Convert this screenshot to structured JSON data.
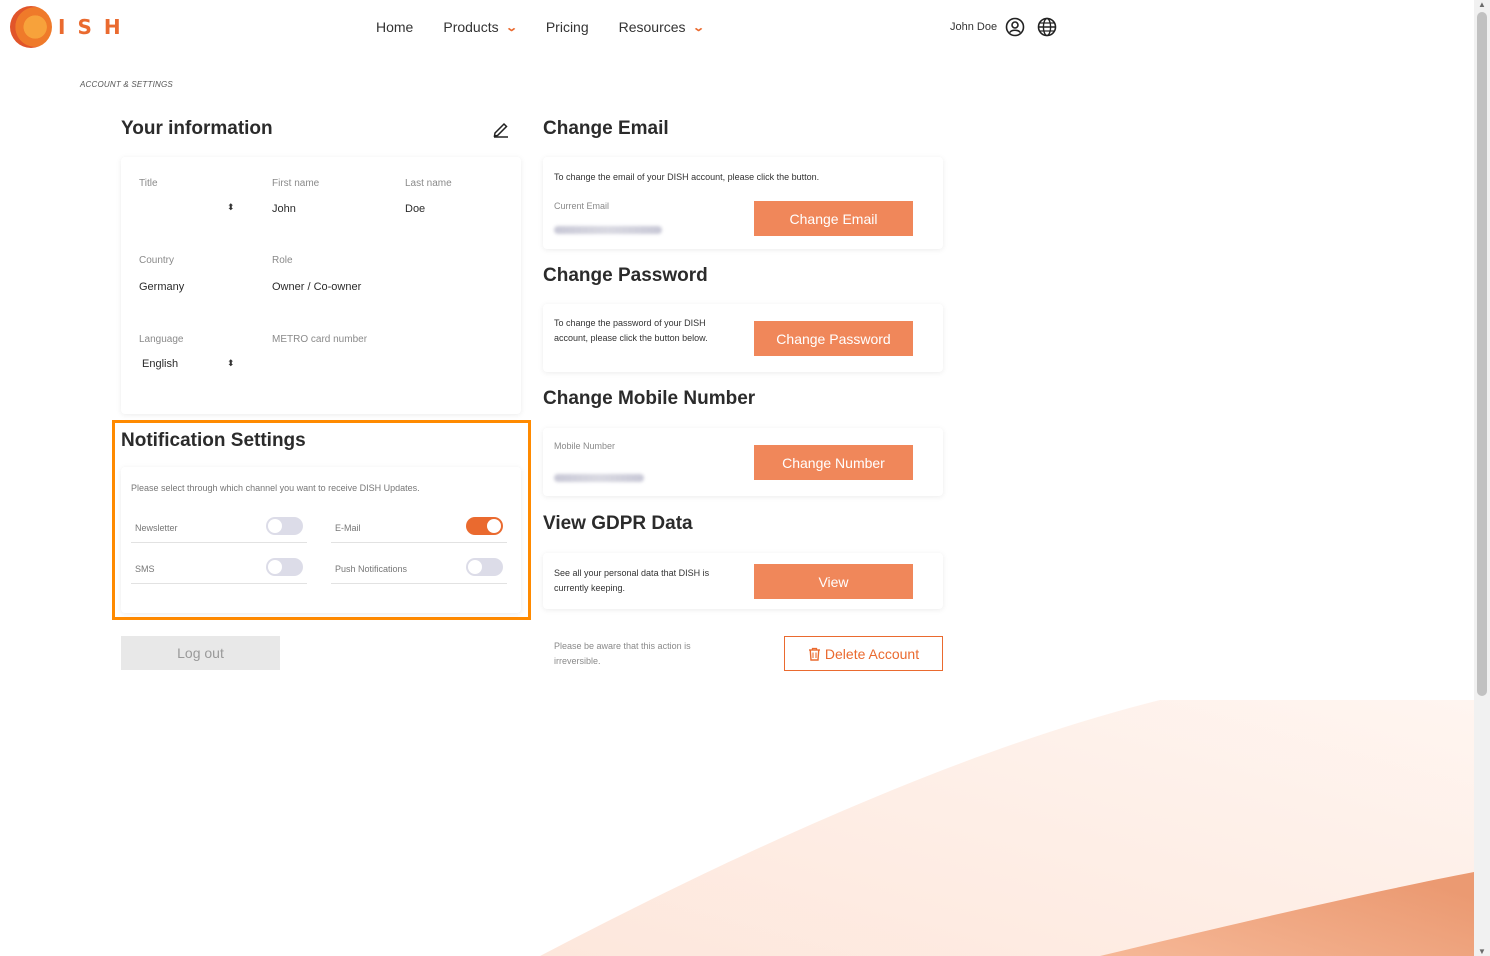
{
  "header": {
    "logo_text": "ISH",
    "nav": [
      {
        "label": "Home",
        "has_dropdown": false
      },
      {
        "label": "Products",
        "has_dropdown": true
      },
      {
        "label": "Pricing",
        "has_dropdown": false
      },
      {
        "label": "Resources",
        "has_dropdown": true
      }
    ],
    "user_name": "John Doe",
    "icons": [
      "user-circle-icon",
      "globe-icon",
      "chevron-down-icon"
    ]
  },
  "breadcrumb": "ACCOUNT & SETTINGS",
  "your_information": {
    "title": "Your information",
    "fields": {
      "title_label": "Title",
      "title_value": "",
      "first_name_label": "First name",
      "first_name_value": "John",
      "last_name_label": "Last name",
      "last_name_value": "Doe",
      "country_label": "Country",
      "country_value": "Germany",
      "role_label": "Role",
      "role_value": "Owner / Co-owner",
      "language_label": "Language",
      "language_value": "English",
      "metro_label": "METRO card number",
      "metro_value": ""
    }
  },
  "notifications": {
    "title": "Notification Settings",
    "description": "Please select through which channel you want to receive DISH Updates.",
    "toggles": [
      {
        "label": "Newsletter",
        "on": false
      },
      {
        "label": "E-Mail",
        "on": true
      },
      {
        "label": "SMS",
        "on": false
      },
      {
        "label": "Push Notifications",
        "on": false
      }
    ]
  },
  "logout_label": "Log out",
  "change_email": {
    "title": "Change Email",
    "text": "To change the email of your DISH account, please click the button.",
    "current_label": "Current Email",
    "button": "Change Email"
  },
  "change_password": {
    "title": "Change Password",
    "text": "To change the password of your DISH account, please click the button below.",
    "button": "Change Password"
  },
  "change_mobile": {
    "title": "Change Mobile Number",
    "label": "Mobile Number",
    "button": "Change Number"
  },
  "gdpr": {
    "title": "View GDPR Data",
    "text": "See all your personal data that DISH is currently keeping.",
    "button": "View"
  },
  "delete": {
    "warning": "Please be aware that this action is irreversible.",
    "button": "Delete Account"
  },
  "colors": {
    "accent": "#ea6a2f",
    "button": "#f0875a",
    "highlight": "#ff8a00"
  }
}
